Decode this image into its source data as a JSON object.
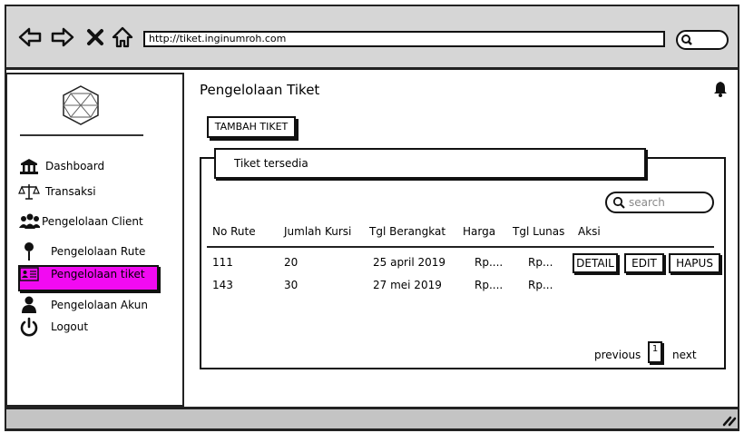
{
  "browser": {
    "url": "http://tiket.inginumroh.com",
    "nav_icons": [
      "back-arrow-icon",
      "forward-arrow-icon",
      "close-icon",
      "home-icon"
    ]
  },
  "sidebar": {
    "items": [
      {
        "label": "Dashboard",
        "icon": "bank-icon"
      },
      {
        "label": "Transaksi",
        "icon": "scales-icon"
      },
      {
        "label": "Pengelolaan Client",
        "icon": "users-icon"
      },
      {
        "label": "Pengelolaan Rute",
        "icon": "pin-icon"
      },
      {
        "label": "Pengelolaan tiket",
        "icon": "id-card-icon",
        "active": true
      },
      {
        "label": "Pengelolaan Akun",
        "icon": "user-icon"
      },
      {
        "label": "Logout",
        "icon": "power-icon"
      }
    ],
    "active_color": "#f20af2"
  },
  "main": {
    "title": "Pengelolaan Tiket",
    "add_button": "TAMBAH TIKET",
    "panel_title": "Tiket tersedia",
    "search_placeholder": "search",
    "columns": [
      "No Rute",
      "Jumlah Kursi",
      "Tgl Berangkat",
      "Harga",
      "Tgl Lunas",
      "Aksi"
    ],
    "rows": [
      {
        "no_rute": "111",
        "jumlah_kursi": "20",
        "tgl_berangkat": "25 april 2019",
        "harga": "Rp....",
        "tgl_lunas": "Rp..."
      },
      {
        "no_rute": "143",
        "jumlah_kursi": "30",
        "tgl_berangkat": "27 mei 2019",
        "harga": "Rp....",
        "tgl_lunas": "Rp..."
      }
    ],
    "actions": [
      "DETAIL",
      "EDIT",
      "HAPUS"
    ],
    "pagination": {
      "previous": "previous",
      "page": "1",
      "next": "next"
    }
  }
}
